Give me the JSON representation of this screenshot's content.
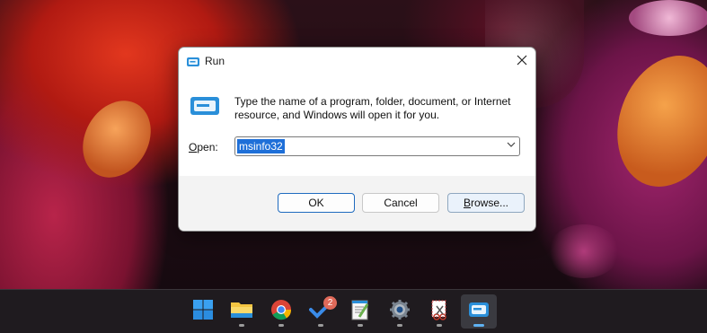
{
  "dialog": {
    "title": "Run",
    "description": "Type the name of a program, folder, document, or Internet resource, and Windows will open it for you.",
    "open_label_first": "O",
    "open_label_rest": "pen:",
    "open_value": "msinfo32",
    "buttons": {
      "ok": "OK",
      "cancel": "Cancel",
      "browse_first": "B",
      "browse_rest": "rowse..."
    }
  },
  "taskbar": {
    "apps": [
      {
        "name": "start",
        "icon": "windows-logo-icon"
      },
      {
        "name": "file-explorer",
        "icon": "folder-icon"
      },
      {
        "name": "chrome",
        "icon": "chrome-icon"
      },
      {
        "name": "todo",
        "icon": "checkmark-icon",
        "badge": "2"
      },
      {
        "name": "notepad",
        "icon": "notepad-icon"
      },
      {
        "name": "settings",
        "icon": "gear-icon"
      },
      {
        "name": "snipping",
        "icon": "snipping-tool-icon"
      },
      {
        "name": "run",
        "icon": "run-icon"
      }
    ]
  },
  "colors": {
    "accent": "#1e6fd8",
    "taskbar": "#1f1b1f"
  }
}
